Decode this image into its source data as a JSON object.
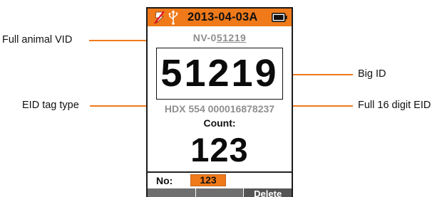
{
  "annotations": {
    "full_animal_vid": "Full animal VID",
    "big_id": "Big ID",
    "eid_tag_type": "EID tag type",
    "full_16_digit_eid": "Full 16 digit EID"
  },
  "device": {
    "status_bar": {
      "date": "2013-04-03A",
      "icons": [
        "no-connection-icon",
        "usb-icon",
        "battery-icon"
      ]
    },
    "vid_prefix": "NV-0",
    "vid_underlined": "51219",
    "big_id": "51219",
    "eid": "HDX 554 000016878237",
    "count_label": "Count:",
    "count_value": "123",
    "no_label": "No:",
    "no_value": "123",
    "softkeys": [
      "",
      "",
      "Delete"
    ]
  },
  "colors": {
    "accent": "#f07a1a",
    "muted_text": "#8f8f8f",
    "softkey_bg": "#6f6f6f"
  }
}
